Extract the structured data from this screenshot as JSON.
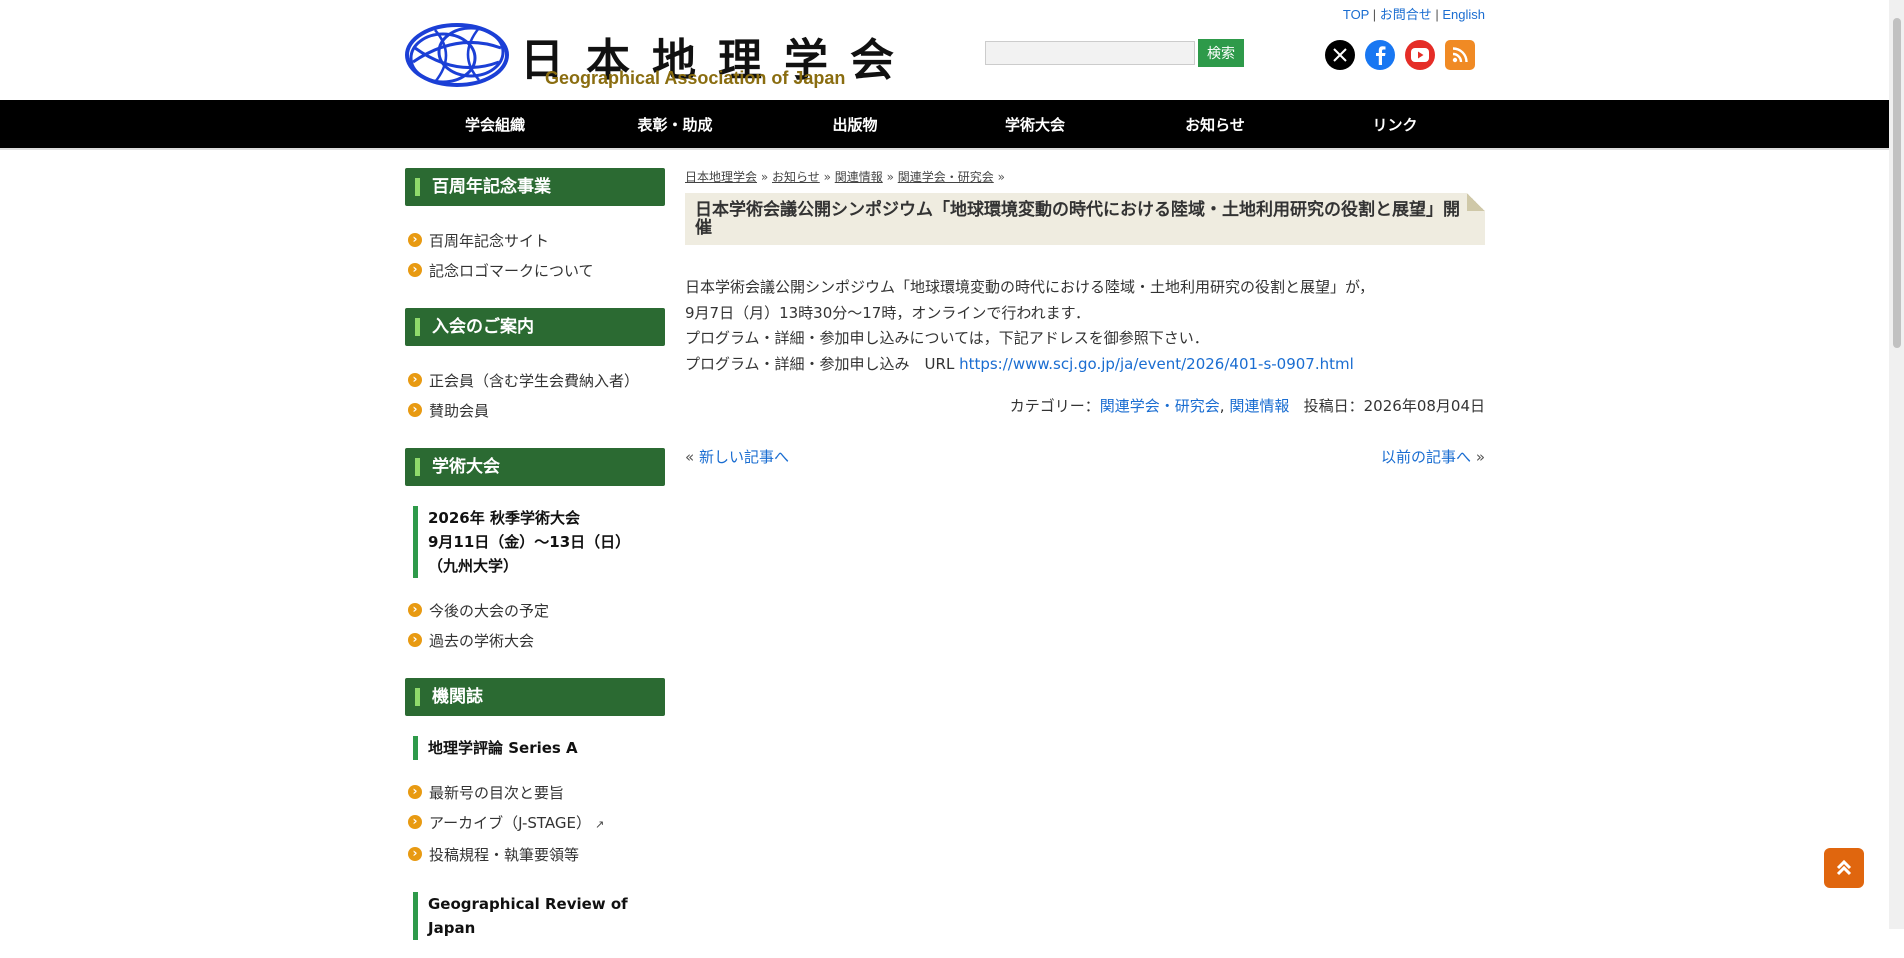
{
  "header": {
    "logo_jp": "日本地理学会",
    "logo_en": "Geographical Association of Japan",
    "toplinks": {
      "top": "TOP",
      "contact": "お問合せ",
      "english": "English"
    },
    "search": {
      "placeholder": "",
      "button": "検索"
    },
    "social_icons": [
      "x-icon",
      "facebook-icon",
      "youtube-icon",
      "rss-icon"
    ],
    "colors": {
      "nav_bg": "#000000",
      "accent_green": "#2b6a32",
      "search_btn": "#2e9a4a",
      "scroll_btn": "#e0660e"
    }
  },
  "nav": [
    "学会組織",
    "表彰・助成",
    "出版物",
    "学術大会",
    "お知らせ",
    "リンク"
  ],
  "sidebar": {
    "centennial": {
      "title": "百周年記念事業",
      "items": [
        "百周年記念サイト",
        "記念ロゴマークについて"
      ]
    },
    "membership": {
      "title": "入会のご案内",
      "items": [
        "正会員（含む学生会費納入者）",
        "賛助会員"
      ]
    },
    "meeting": {
      "title": "学術大会",
      "highlight": [
        "2026年 秋季学術大会",
        "9月11日（金）〜13日（日）",
        "（九州大学）"
      ],
      "items": [
        "今後の大会の予定",
        "過去の学術大会"
      ]
    },
    "journal": {
      "title": "機関誌",
      "sub1": "地理学評論 Series A",
      "items": [
        "最新号の目次と要旨",
        "アーカイブ（J-STAGE）",
        "投稿規程・執筆要領等"
      ],
      "sub2": "Geographical Review of Japan"
    }
  },
  "breadcrumb": [
    "日本地理学会",
    "お知らせ",
    "関連情報",
    "関連学会・研究会"
  ],
  "article": {
    "title": "日本学術会議公開シンポジウム「地球環境変動の時代における陸域・土地利用研究の役割と展望」開催",
    "lines": [
      "日本学術会議公開シンポジウム「地球環境変動の時代における陸域・土地利用研究の役割と展望」が，",
      "9月7日（月）13時30分〜17時，オンラインで行われます．",
      "プログラム・詳細・参加申し込みについては，下記アドレスを御参照下さい．"
    ],
    "url_prefix": "プログラム・詳細・参加申し込み　URL ",
    "url": "https://www.scj.go.jp/ja/event/2026/401-s-0907.html",
    "category_label": "カテゴリー：",
    "categories": [
      "関連学会・研究会",
      "関連情報"
    ],
    "posted": "投稿日：2026年08月04日"
  },
  "pager": {
    "newer": "新しい記事へ",
    "older": "以前の記事へ"
  }
}
